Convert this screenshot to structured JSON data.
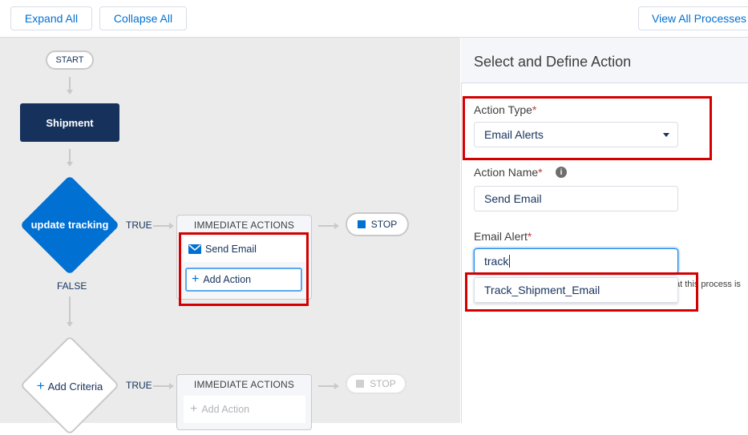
{
  "toolbar": {
    "expand_all": "Expand All",
    "collapse_all": "Collapse All",
    "view_all_processes": "View All Processes"
  },
  "canvas": {
    "start": "START",
    "object_node": "Shipment",
    "criteria_1": "update tracking",
    "true_label_1": "TRUE",
    "false_label": "FALSE",
    "immediate_actions_1": "IMMEDIATE ACTIONS",
    "action_send_email": "Send Email",
    "add_action_1": "Add Action",
    "stop_1": "STOP",
    "criteria_2": "Add Criteria",
    "true_label_2": "TRUE",
    "immediate_actions_2": "IMMEDIATE ACTIONS",
    "add_action_2": "Add Action",
    "stop_2": "STOP"
  },
  "panel": {
    "title": "Select and Define Action",
    "action_type_label": "Action Type",
    "action_type_value": "Email Alerts",
    "action_name_label": "Action Name",
    "action_name_value": "Send Email",
    "email_alert_label": "Email Alert",
    "email_alert_value": "track",
    "suggestion": "Track_Shipment_Email",
    "clipped_text": "at this process is"
  },
  "colors": {
    "accent": "#0070d2",
    "node_dark": "#16325c",
    "diamond": "#0070d2",
    "highlight": "#d40000"
  },
  "icons": {
    "required": "*",
    "info": "info-icon",
    "dropdown": "chevron-down-icon",
    "email": "envelope-icon",
    "add": "plus-icon",
    "stop": "square-icon"
  }
}
